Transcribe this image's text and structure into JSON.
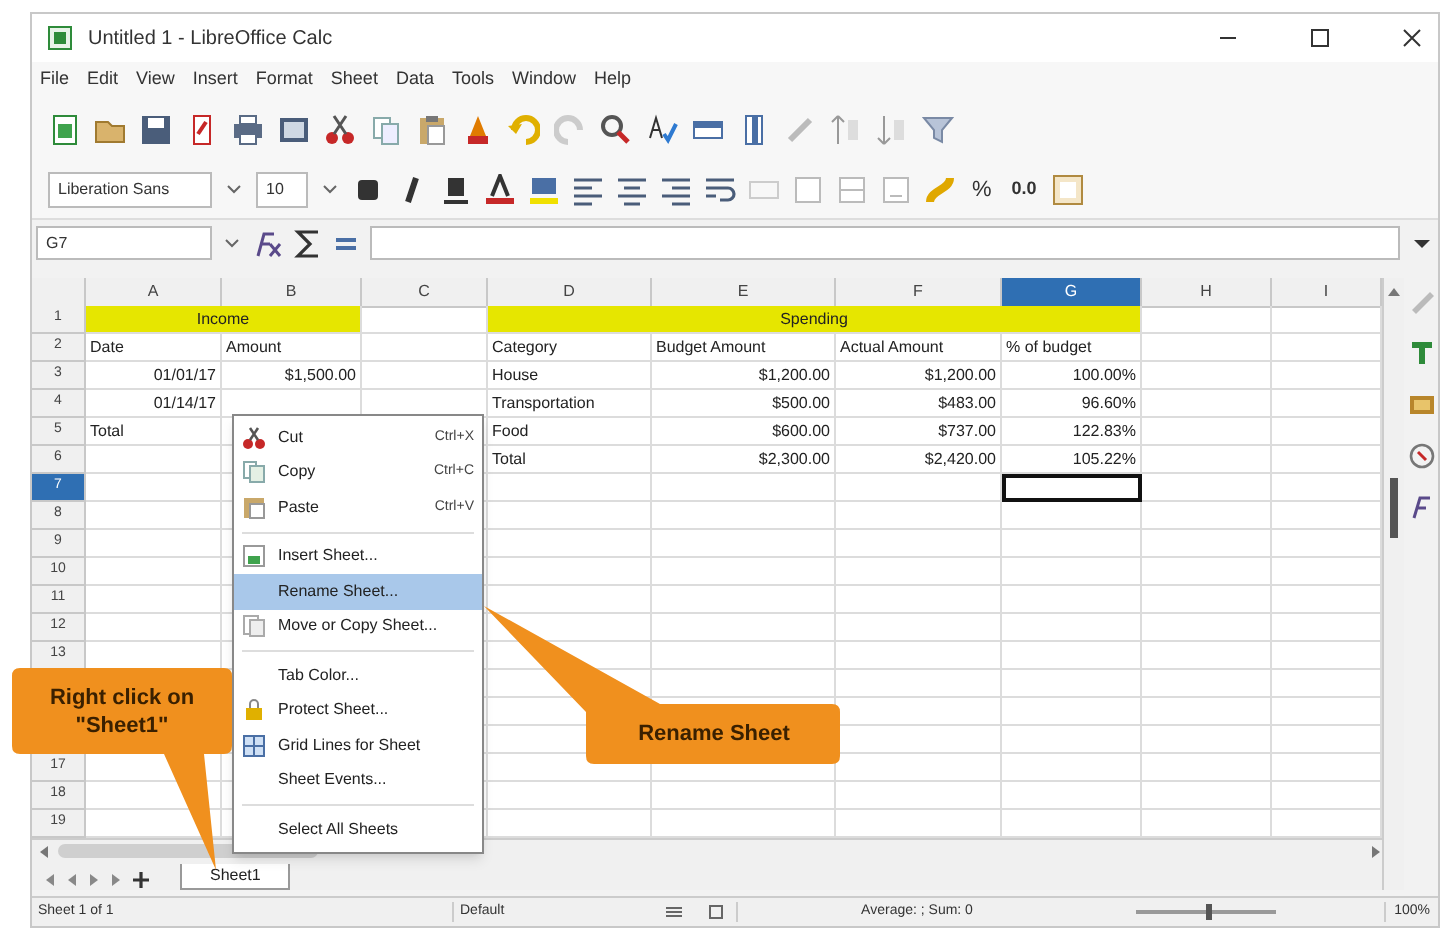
{
  "window": {
    "title": "Untitled 1 - LibreOffice Calc"
  },
  "menu_bar": [
    "File",
    "Edit",
    "View",
    "Insert",
    "Format",
    "Sheet",
    "Data",
    "Tools",
    "Window",
    "Help"
  ],
  "formatting_toolbar": {
    "font_name": "Liberation Sans",
    "font_size": "10",
    "percent_button": "%",
    "decimal_button": "0.0"
  },
  "formula_bar": {
    "name_box": "G7"
  },
  "sheet": {
    "columns": [
      {
        "label": "A",
        "selected": false
      },
      {
        "label": "B",
        "selected": false
      },
      {
        "label": "C",
        "selected": false
      },
      {
        "label": "D",
        "selected": false
      },
      {
        "label": "E",
        "selected": false
      },
      {
        "label": "F",
        "selected": false
      },
      {
        "label": "G",
        "selected": true
      },
      {
        "label": "H",
        "selected": false
      },
      {
        "label": "I",
        "selected": false
      }
    ],
    "rows": [
      {
        "number": "1",
        "selected": false,
        "cells": [
          {
            "kind": "band",
            "text": "Income"
          },
          {
            "kind": "band_continued"
          },
          null,
          {
            "kind": "band_lead"
          },
          {
            "kind": "band",
            "text": "Spending"
          },
          {
            "kind": "band_continued"
          },
          {
            "kind": "band_continued"
          },
          null,
          null
        ]
      },
      {
        "number": "2",
        "selected": false,
        "cells": [
          {
            "kind": "label",
            "text": "Date"
          },
          {
            "kind": "label",
            "text": "Amount"
          },
          null,
          {
            "kind": "label",
            "text": "Category"
          },
          {
            "kind": "label",
            "text": "Budget Amount"
          },
          {
            "kind": "label",
            "text": "Actual Amount"
          },
          {
            "kind": "label",
            "text": "% of budget"
          },
          null,
          null
        ]
      },
      {
        "number": "3",
        "selected": false,
        "cells": [
          {
            "kind": "value",
            "text": "01/01/17"
          },
          {
            "kind": "value",
            "text": "$1,500.00"
          },
          null,
          {
            "kind": "label",
            "text": "House"
          },
          {
            "kind": "value",
            "text": "$1,200.00"
          },
          {
            "kind": "value",
            "text": "$1,200.00"
          },
          {
            "kind": "value",
            "text": "100.00%"
          },
          null,
          null
        ]
      },
      {
        "number": "4",
        "selected": false,
        "cells": [
          {
            "kind": "value",
            "text": "01/14/17"
          },
          null,
          null,
          {
            "kind": "label",
            "text": "Transportation"
          },
          {
            "kind": "value",
            "text": "$500.00"
          },
          {
            "kind": "value",
            "text": "$483.00"
          },
          {
            "kind": "value",
            "text": "96.60%"
          },
          null,
          null
        ]
      },
      {
        "number": "5",
        "selected": false,
        "cells": [
          {
            "kind": "label",
            "text": "Total"
          },
          null,
          null,
          {
            "kind": "label",
            "text": "Food"
          },
          {
            "kind": "value",
            "text": "$600.00"
          },
          {
            "kind": "value",
            "text": "$737.00"
          },
          {
            "kind": "value",
            "text": "122.83%"
          },
          null,
          null
        ]
      },
      {
        "number": "6",
        "selected": false,
        "cells": [
          null,
          null,
          null,
          {
            "kind": "label",
            "text": "Total"
          },
          {
            "kind": "value",
            "text": "$2,300.00"
          },
          {
            "kind": "value",
            "text": "$2,420.00"
          },
          {
            "kind": "value",
            "text": "105.22%"
          },
          null,
          null
        ]
      },
      {
        "number": "7",
        "selected": true,
        "cells": []
      },
      {
        "number": "8",
        "selected": false,
        "cells": []
      },
      {
        "number": "9",
        "selected": false,
        "cells": []
      },
      {
        "number": "10",
        "selected": false,
        "cells": []
      },
      {
        "number": "11",
        "selected": false,
        "cells": []
      },
      {
        "number": "12",
        "selected": false,
        "cells": []
      },
      {
        "number": "13",
        "selected": false,
        "cells": []
      },
      {
        "cells": []
      },
      {
        "cells": []
      },
      {
        "cells": []
      },
      {
        "number": "17",
        "selected": false,
        "cells": []
      },
      {
        "number": "18",
        "selected": false,
        "cells": []
      },
      {
        "number": "19",
        "selected": false,
        "cells": []
      }
    ]
  },
  "context_menu": {
    "groups": [
      [
        {
          "label": "Cut",
          "shortcut": "Ctrl+X",
          "selected": false
        },
        {
          "label": "Copy",
          "shortcut": "Ctrl+C",
          "selected": false
        },
        {
          "label": "Paste",
          "shortcut": "Ctrl+V",
          "selected": false
        }
      ],
      [
        {
          "label": "Insert Sheet...",
          "selected": false
        },
        {
          "label": "Rename Sheet...",
          "selected": true
        },
        {
          "label": "Move or Copy Sheet...",
          "selected": false
        }
      ],
      [
        {
          "label": "Tab Color...",
          "selected": false
        },
        {
          "label": "Protect Sheet...",
          "selected": false
        },
        {
          "label": "Grid Lines for Sheet",
          "selected": false
        },
        {
          "label": "Sheet Events...",
          "selected": false
        }
      ],
      [
        {
          "label": "Select All Sheets",
          "selected": false
        }
      ]
    ]
  },
  "sheet_tabs": [
    {
      "label": "Sheet1",
      "selected": true
    }
  ],
  "status_bar": {
    "sheet_position": "Sheet 1 of 1",
    "page_style": "Default",
    "summary": "Average: ; Sum: 0",
    "zoom": "100%",
    "zoom_slider": {
      "level": 0.5
    }
  },
  "callouts": [
    {
      "text": "Right click on \"Sheet1\""
    },
    {
      "text": "Rename Sheet"
    }
  ]
}
